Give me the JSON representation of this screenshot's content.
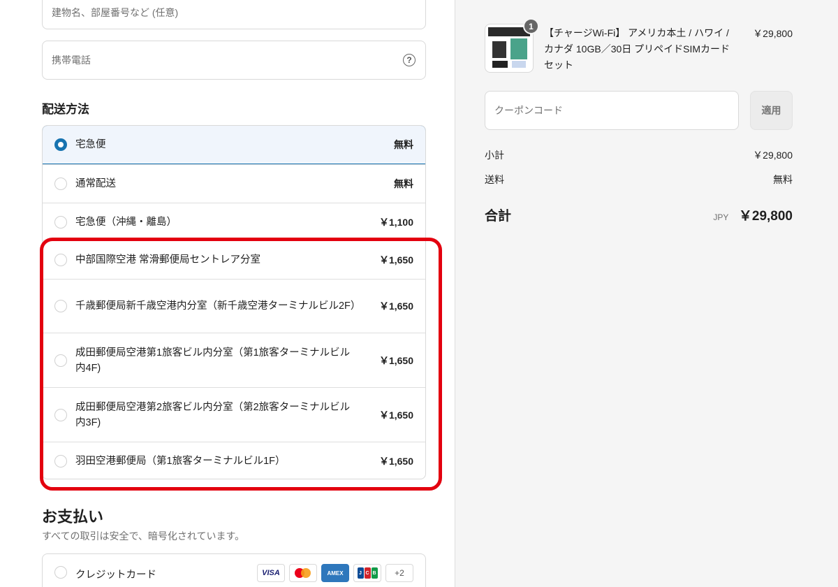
{
  "address": {
    "building_placeholder": "建物名、部屋番号など (任意)",
    "phone_placeholder": "携帯電話",
    "phone_help": "?"
  },
  "shipping": {
    "title": "配送方法",
    "options": [
      {
        "name": "宅急便",
        "price": "無料",
        "selected": true
      },
      {
        "name": "通常配送",
        "price": "無料",
        "selected": false
      },
      {
        "name": "宅急便（沖縄・離島）",
        "price": "￥1,100",
        "selected": false
      },
      {
        "name": "中部国際空港 常滑郵便局セントレア分室",
        "price": "￥1,650",
        "selected": false
      },
      {
        "name": "千歳郵便局新千歳空港内分室（新千歳空港ターミナルビル2F）",
        "price": "￥1,650",
        "selected": false
      },
      {
        "name": "成田郵便局空港第1旅客ビル内分室（第1旅客ターミナルビル内4F)",
        "price": "￥1,650",
        "selected": false
      },
      {
        "name": "成田郵便局空港第2旅客ビル内分室（第2旅客ターミナルビル内3F)",
        "price": "￥1,650",
        "selected": false
      },
      {
        "name": "羽田空港郵便局（第1旅客ターミナルビル1F）",
        "price": "￥1,650",
        "selected": false
      }
    ]
  },
  "payment": {
    "title": "お支払い",
    "subtitle": "すべての取引は安全で、暗号化されています。",
    "method_label": "クレジットカード",
    "cards": {
      "visa": "VISA",
      "amex": "AMEX",
      "jcb": [
        "J",
        "C",
        "B"
      ],
      "more": "+2"
    }
  },
  "order": {
    "quantity": "1",
    "product_name": "【チャージWi-Fi】 アメリカ本土 / ハワイ / カナダ 10GB／30日 プリペイドSIMカード セット",
    "product_price": "￥29,800",
    "coupon_placeholder": "クーポンコード",
    "apply_label": "適用",
    "subtotal_label": "小計",
    "subtotal_value": "￥29,800",
    "shipping_label": "送料",
    "shipping_value": "無料",
    "total_label": "合計",
    "total_currency": "JPY",
    "total_value": "￥29,800"
  },
  "colors": {
    "accent": "#1773b0",
    "highlight": "#e3000f",
    "sidebar_bg": "#f5f5f5"
  }
}
